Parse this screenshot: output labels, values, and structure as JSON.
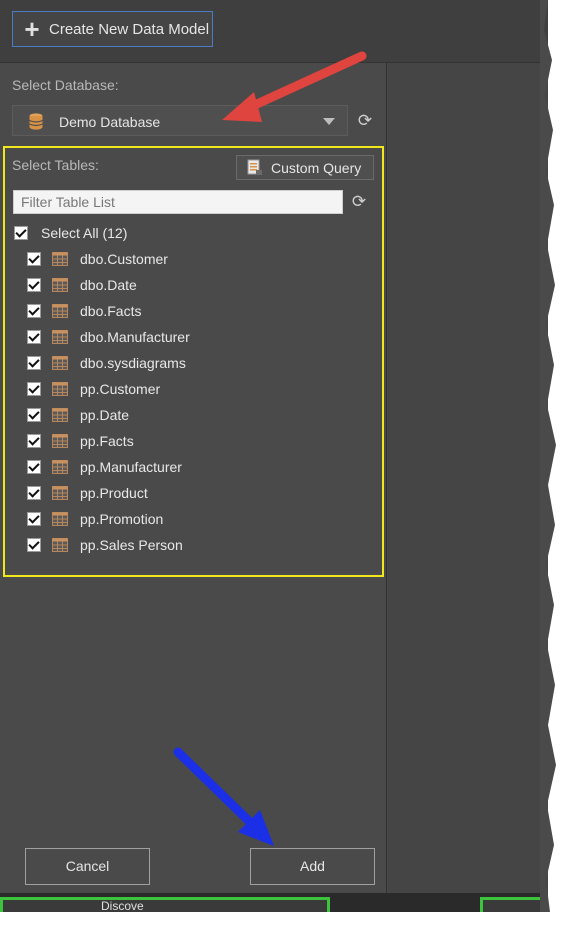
{
  "toolbar": {
    "create_label": "Create New Data Model"
  },
  "database": {
    "label": "Select Database:",
    "selected": "Demo Database"
  },
  "tables": {
    "label": "Select Tables:",
    "custom_query_label": "Custom Query",
    "filter_placeholder": "Filter Table List",
    "select_all_label": "Select All (12)",
    "items": [
      {
        "name": "dbo.Customer",
        "checked": true
      },
      {
        "name": "dbo.Date",
        "checked": true
      },
      {
        "name": "dbo.Facts",
        "checked": true
      },
      {
        "name": "dbo.Manufacturer",
        "checked": true
      },
      {
        "name": "dbo.sysdiagrams",
        "checked": true
      },
      {
        "name": "pp.Customer",
        "checked": true
      },
      {
        "name": "pp.Date",
        "checked": true
      },
      {
        "name": "pp.Facts",
        "checked": true
      },
      {
        "name": "pp.Manufacturer",
        "checked": true
      },
      {
        "name": "pp.Product",
        "checked": true
      },
      {
        "name": "pp.Promotion",
        "checked": true
      },
      {
        "name": "pp.Sales Person",
        "checked": true
      }
    ]
  },
  "footer": {
    "cancel_label": "Cancel",
    "add_label": "Add"
  },
  "bottom_tab": {
    "label": "Discove"
  },
  "colors": {
    "highlight_box": "#f0e81c",
    "red_arrow": "#e0443e",
    "blue_arrow": "#1a2fe6",
    "tab_highlight": "#3cc43c",
    "create_border": "#4a7cc4"
  },
  "icons": [
    "plus-icon",
    "database-icon",
    "refresh-icon",
    "custom-query-icon",
    "table-icon",
    "checkbox-checked-icon",
    "chevron-down-icon"
  ]
}
